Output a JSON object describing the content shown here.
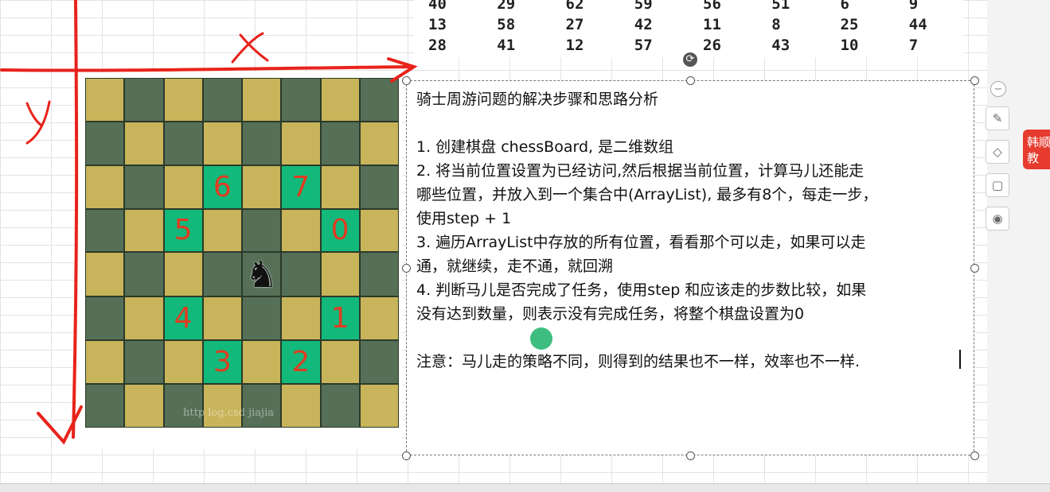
{
  "number_table": [
    [
      "40",
      "29",
      "62",
      "59",
      "56",
      "51",
      "6",
      "9"
    ],
    [
      "13",
      "58",
      "27",
      "42",
      "11",
      "8",
      "25",
      "44"
    ],
    [
      "28",
      "41",
      "12",
      "57",
      "26",
      "43",
      "10",
      "7"
    ]
  ],
  "board": {
    "labels": {
      "r2c3": "6",
      "r2c5": "7",
      "r3c2": "5",
      "r3c6": "0",
      "r5c2": "4",
      "r5c6": "1",
      "r6c3": "3",
      "r6c5": "2"
    },
    "knight_icon": "knight-icon",
    "watermark": "http  log.csd   jiajia"
  },
  "annotations": {
    "x_label": "x",
    "y_label": "y",
    "color": "#e8231b"
  },
  "textbox": {
    "lines": [
      "骑士周游问题的解决步骤和思路分析",
      "",
      "1. 创建棋盘 chessBoard, 是二维数组",
      "2. 将当前位置设置为已经访问,然后根据当前位置，计算马儿还能走",
      "哪些位置，并放入到一个集合中(ArrayList), 最多有8个，每走一步，",
      "使用step + 1",
      "3. 遍历ArrayList中存放的所有位置，看看那个可以走，如果可以走",
      "通，就继续，走不通，就回溯",
      "4. 判断马儿是否完成了任务，使用step 和应该走的步数比较，如果",
      "没有达到数量，则表示没有完成任务，将整个棋盘设置为0",
      "",
      "注意：马儿走的策略不同，则得到的结果也不一样，效率也不一样."
    ]
  },
  "side_badge": {
    "line1": "韩顺",
    "line2": "教"
  },
  "colors": {
    "yellow": "#c8b45a",
    "dark": "#566f57",
    "teal": "#13b97a",
    "label": "#e23b22"
  }
}
